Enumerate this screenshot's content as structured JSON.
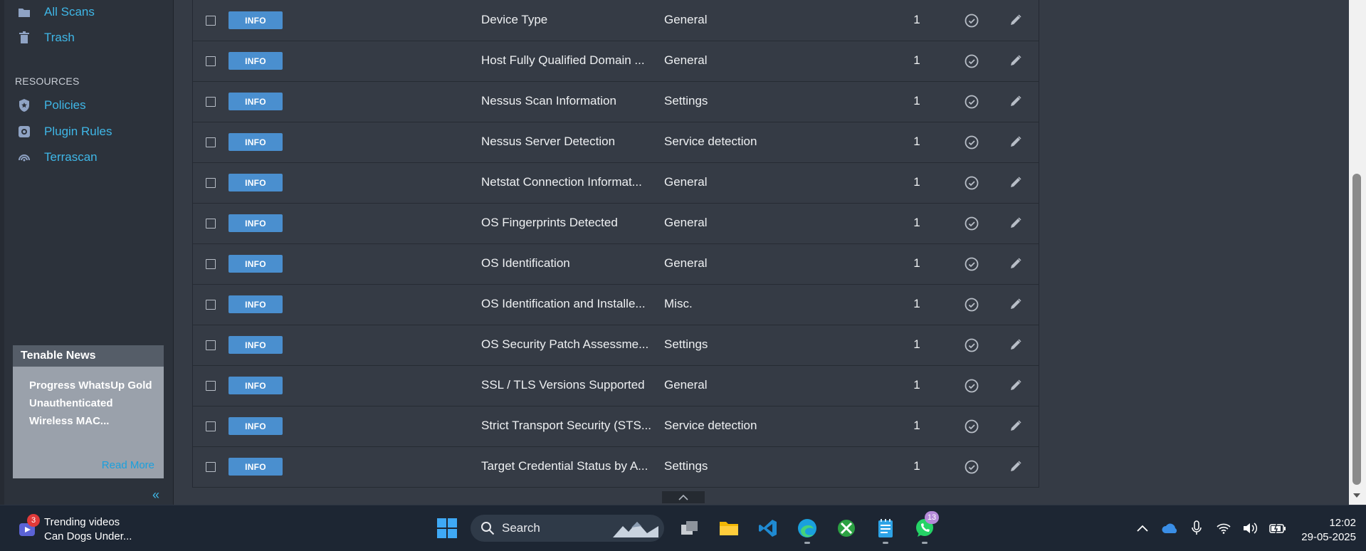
{
  "sidebar": {
    "nav_top": [
      {
        "label": "All Scans",
        "icon": "folder-icon"
      },
      {
        "label": "Trash",
        "icon": "trash-icon"
      }
    ],
    "resources_label": "RESOURCES",
    "resources": [
      {
        "label": "Policies",
        "icon": "policy-shield-icon"
      },
      {
        "label": "Plugin Rules",
        "icon": "plugin-rules-icon"
      },
      {
        "label": "Terrascan",
        "icon": "terrascan-icon"
      }
    ],
    "news": {
      "title": "Tenable News",
      "body": "Progress WhatsUp Gold Unauthenticated Wireless MAC...",
      "read_more": "Read More"
    },
    "collapse_glyph": "«"
  },
  "table": {
    "rows": [
      {
        "severity": "INFO",
        "name": "Device Type",
        "family": "General",
        "count": "1"
      },
      {
        "severity": "INFO",
        "name": "Host Fully Qualified Domain ...",
        "family": "General",
        "count": "1"
      },
      {
        "severity": "INFO",
        "name": "Nessus Scan Information",
        "family": "Settings",
        "count": "1"
      },
      {
        "severity": "INFO",
        "name": "Nessus Server Detection",
        "family": "Service detection",
        "count": "1"
      },
      {
        "severity": "INFO",
        "name": "Netstat Connection Informat...",
        "family": "General",
        "count": "1"
      },
      {
        "severity": "INFO",
        "name": "OS Fingerprints Detected",
        "family": "General",
        "count": "1"
      },
      {
        "severity": "INFO",
        "name": "OS Identification",
        "family": "General",
        "count": "1"
      },
      {
        "severity": "INFO",
        "name": "OS Identification and Installe...",
        "family": "Misc.",
        "count": "1"
      },
      {
        "severity": "INFO",
        "name": "OS Security Patch Assessme...",
        "family": "Settings",
        "count": "1"
      },
      {
        "severity": "INFO",
        "name": "SSL / TLS Versions Supported",
        "family": "General",
        "count": "1"
      },
      {
        "severity": "INFO",
        "name": "Strict Transport Security (STS...",
        "family": "Service detection",
        "count": "1"
      },
      {
        "severity": "INFO",
        "name": "Target Credential Status by A...",
        "family": "Settings",
        "count": "1"
      }
    ],
    "scroll_up_glyph": "^"
  },
  "taskbar": {
    "widget": {
      "badge": "3",
      "line1": "Trending videos",
      "line2": "Can Dogs Under..."
    },
    "search_label": "Search",
    "whatsapp_badge": "13",
    "clock": {
      "time": "12:02",
      "date": "29-05-2025"
    }
  },
  "colors": {
    "accent": "#3fb7e7",
    "info_badge": "#4a8fcf",
    "background": "#353b45",
    "sidebar": "#2c323b",
    "taskbar": "#1d2633"
  }
}
